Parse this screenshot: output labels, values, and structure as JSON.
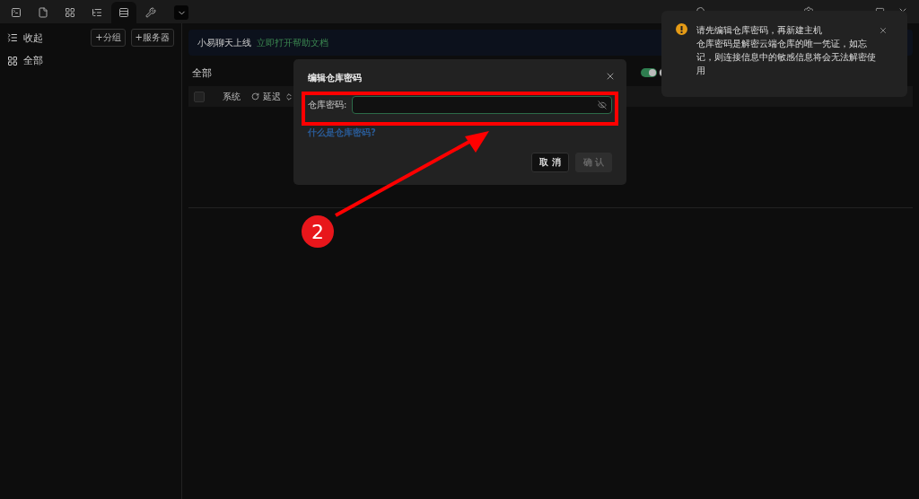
{
  "toolbar": {
    "tabs": [
      {
        "selected": false
      },
      {
        "selected": false
      },
      {
        "selected": false
      },
      {
        "selected": false
      },
      {
        "selected": true
      },
      {
        "selected": false
      }
    ]
  },
  "sidebar": {
    "collapse": "收起",
    "add_group": "+分组",
    "add_server": "+服务器",
    "items": [
      {
        "label": "全部",
        "selected": false
      }
    ]
  },
  "banner": {
    "text": "小易聊天上线",
    "link": "立即打开帮助文档"
  },
  "main": {
    "title": "全部",
    "toggles": [
      {
        "on": true
      },
      {
        "on": false
      }
    ],
    "select_all_checked": false,
    "columns": [
      "系统",
      "延迟"
    ]
  },
  "dialog": {
    "title": "编辑仓库密码",
    "field_label": "仓库密码:",
    "help_link": "什么是仓库密码?",
    "cancel": "取 消",
    "confirm": "确 认",
    "confirm_disabled": true
  },
  "toast": {
    "title": "请先编辑仓库密码，再新建主机",
    "message": "仓库密码是解密云端仓库的唯一凭证，如忘记，则连接信息中的敏感信息将会无法解密使用"
  },
  "annotation": {
    "step": "2"
  }
}
